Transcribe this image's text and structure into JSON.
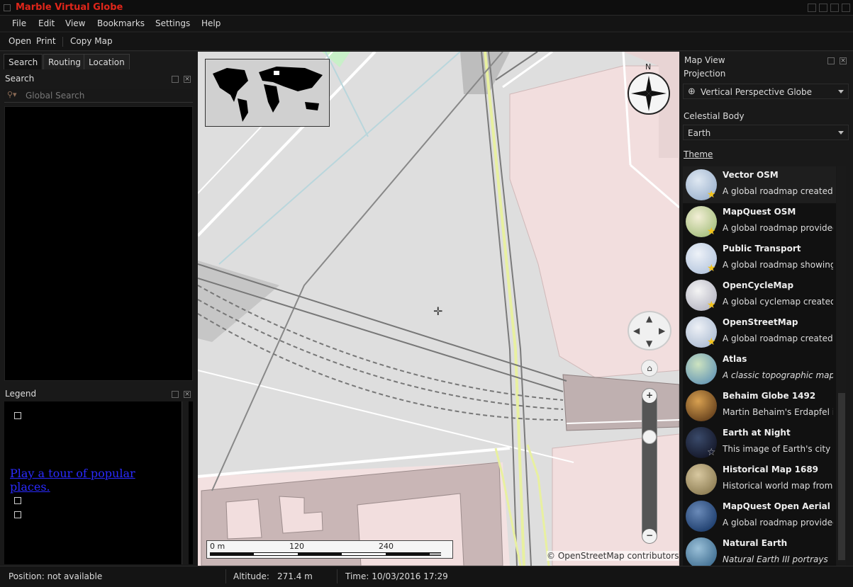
{
  "app": {
    "title": "Marble Virtual Globe"
  },
  "menu": {
    "file": "File",
    "edit": "Edit",
    "view": "View",
    "bookmarks": "Bookmarks",
    "settings": "Settings",
    "help": "Help"
  },
  "toolbar": {
    "open": "Open",
    "print": "Print",
    "copy_map": "Copy Map"
  },
  "left_tabs": {
    "search": "Search",
    "routing": "Routing",
    "location": "Location"
  },
  "search_panel": {
    "title": "Search",
    "placeholder": "Global Search"
  },
  "legend_panel": {
    "title": "Legend",
    "tour_link": "Play a tour of popular places."
  },
  "map": {
    "attribution": "© OpenStreetMap contributors",
    "compass_north": "N",
    "scale_labels": {
      "start": "0 m",
      "mid": "120",
      "end": "240"
    },
    "zoom_in": "+",
    "zoom_out": "−"
  },
  "right_panel": {
    "title": "Map View",
    "projection_label": "Projection",
    "projection_value": "Vertical Perspective Globe",
    "celestial_label": "Celestial Body",
    "celestial_value": "Earth",
    "theme_label": "Theme",
    "themes": [
      {
        "name": "Vector OSM",
        "desc": "A global roadmap created",
        "icon": "vector-osm-globe-icon",
        "favorite": true
      },
      {
        "name": "MapQuest OSM",
        "desc": "A global roadmap provided",
        "icon": "mapquest-globe-icon",
        "favorite": true
      },
      {
        "name": "Public Transport",
        "desc": "A global roadmap showing",
        "icon": "transport-globe-icon",
        "favorite": true
      },
      {
        "name": "OpenCycleMap",
        "desc": "A global cyclemap created",
        "icon": "bicycle-globe-icon",
        "favorite": true
      },
      {
        "name": "OpenStreetMap",
        "desc": "A global roadmap created",
        "icon": "osm-globe-icon",
        "favorite": true
      },
      {
        "name": "Atlas",
        "desc": "A classic topographic map.",
        "icon": "atlas-globe-icon",
        "favorite": false
      },
      {
        "name": "Behaim Globe 1492",
        "desc": "Martin Behaim's Erdapfel is",
        "icon": "behaim-globe-icon",
        "favorite": false
      },
      {
        "name": "Earth at Night",
        "desc": "This image of Earth's city",
        "icon": "night-globe-icon",
        "favorite": false
      },
      {
        "name": "Historical Map 1689",
        "desc": "Historical world map from",
        "icon": "historical-globe-icon",
        "favorite": false
      },
      {
        "name": "MapQuest Open Aerial",
        "desc": "A global roadmap provided",
        "icon": "aerial-globe-icon",
        "favorite": false
      },
      {
        "name": "Natural Earth",
        "desc": "Natural Earth III portrays",
        "icon": "natural-earth-globe-icon",
        "favorite": false
      }
    ]
  },
  "status": {
    "position": "Position: not available",
    "altitude_label": "Altitude:",
    "altitude_value": "271.4 m",
    "time": "Time: 10/03/2016 17:29"
  }
}
